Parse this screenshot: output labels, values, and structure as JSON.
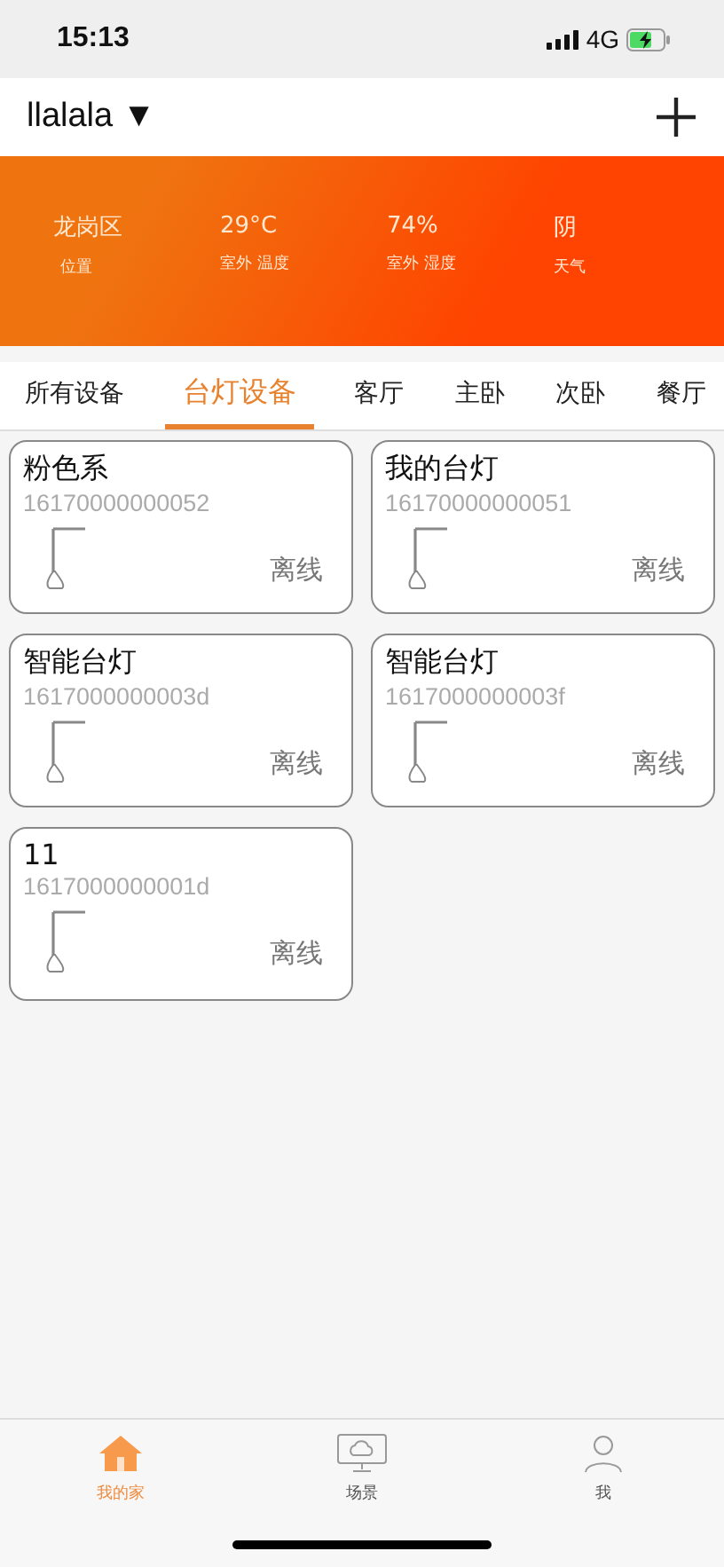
{
  "status_bar": {
    "time": "15:13",
    "network": "4G"
  },
  "header": {
    "home_name": "llalala",
    "dropdown_glyph": "▼"
  },
  "weather": [
    {
      "value": "龙岗区",
      "label": "位置"
    },
    {
      "value": "29°C",
      "label": "室外 温度"
    },
    {
      "value": "74%",
      "label": "室外 湿度"
    },
    {
      "value": "阴",
      "label": "天气"
    }
  ],
  "tabs": [
    {
      "label": "所有设备",
      "selected": false
    },
    {
      "label": "台灯设备",
      "selected": true
    },
    {
      "label": "客厅",
      "selected": false
    },
    {
      "label": "主卧",
      "selected": false
    },
    {
      "label": "次卧",
      "selected": false
    },
    {
      "label": "餐厅",
      "selected": false
    }
  ],
  "devices": [
    {
      "name": "粉色系",
      "id": "16170000000052",
      "status": "离线"
    },
    {
      "name": "我的台灯",
      "id": "16170000000051",
      "status": "离线"
    },
    {
      "name": "智能台灯",
      "id": "1617000000003d",
      "status": "离线"
    },
    {
      "name": "智能台灯",
      "id": "1617000000003f",
      "status": "离线"
    },
    {
      "name": "11",
      "id": "1617000000001d",
      "status": "离线"
    }
  ],
  "bottom_nav": [
    {
      "label": "我的家",
      "kind": "home",
      "selected": true
    },
    {
      "label": "场景",
      "kind": "scene",
      "selected": false
    },
    {
      "label": "我",
      "kind": "me",
      "selected": false
    }
  ]
}
